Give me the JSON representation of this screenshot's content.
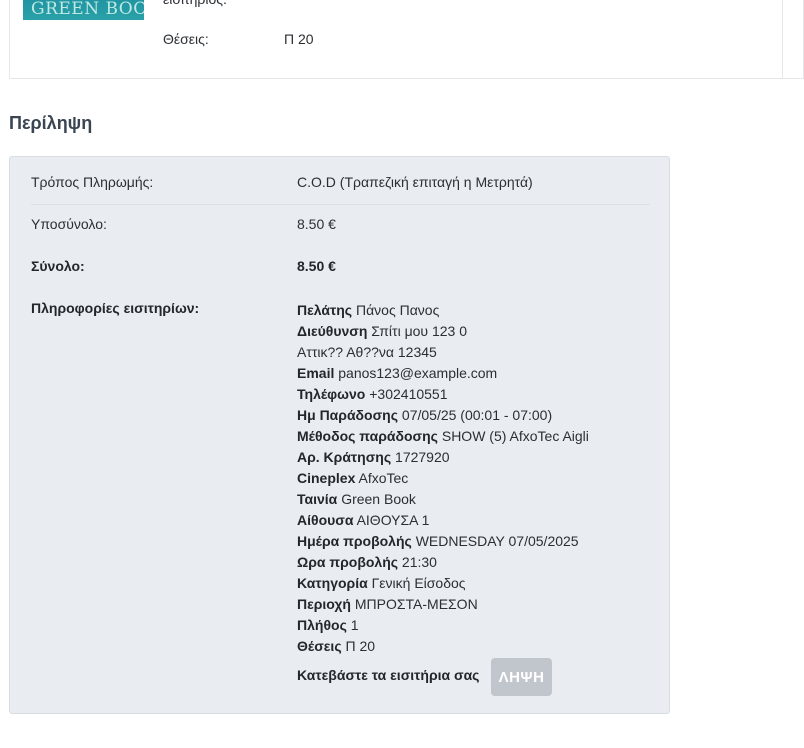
{
  "ticket_card": {
    "poster_title": "GREEN BOOK",
    "cut_text": "εισιτήριος.",
    "seats_label": "Θέσεις:",
    "seats_value": "Π 20"
  },
  "summary": {
    "title": "Περίληψη",
    "payment_label": "Τρόπος Πληρωμής:",
    "payment_value": "C.O.D (Τραπεζική επιταγή η Μετρητά)",
    "subtotal_label": "Υποσύνολο:",
    "subtotal_value": "8.50 €",
    "total_label": "Σύνολο:",
    "total_value": "8.50 €",
    "ticket_info_label": "Πληροφορίες εισιτηρίων:",
    "ticket_info": [
      {
        "key": "Πελάτης",
        "value": "Πάνος Πανος"
      },
      {
        "key": "Διεύθυνση",
        "value": "Σπίτι μου 123 0"
      },
      {
        "key": "",
        "value": "Αττικ?? Αθ??να 12345"
      },
      {
        "key": "Email",
        "value": "panos123@example.com"
      },
      {
        "key": "Τηλέφωνο",
        "value": "+302410551"
      },
      {
        "key": "Ημ Παράδοσης",
        "value": "07/05/25 (00:01 - 07:00)"
      },
      {
        "key": "Μέθοδος παράδοσης",
        "value": "SHOW (5) AfxoTec Aigli"
      },
      {
        "key": "Αρ. Κράτησης",
        "value": "1727920"
      },
      {
        "key": "Cineplex",
        "value": "AfxoTec"
      },
      {
        "key": "Ταινία",
        "value": "Green Book"
      },
      {
        "key": "Αίθουσα",
        "value": "ΑΙΘΟΥΣΑ 1"
      },
      {
        "key": "Ημέρα προβολής",
        "value": "WEDNESDAY 07/05/2025"
      },
      {
        "key": "Ωρα προβολής",
        "value": "21:30"
      },
      {
        "key": "Κατηγορία",
        "value": "Γενική Είσοδος"
      },
      {
        "key": "Περιοχή",
        "value": "ΜΠΡΟΣΤΑ-ΜΕΣΟΝ"
      },
      {
        "key": "Πλήθος",
        "value": "1"
      },
      {
        "key": "Θέσεις",
        "value": "Π 20"
      }
    ],
    "download_label": "Κατεβάστε τα εισιτήρια σας",
    "download_button": "ΛΗΨΗ"
  }
}
